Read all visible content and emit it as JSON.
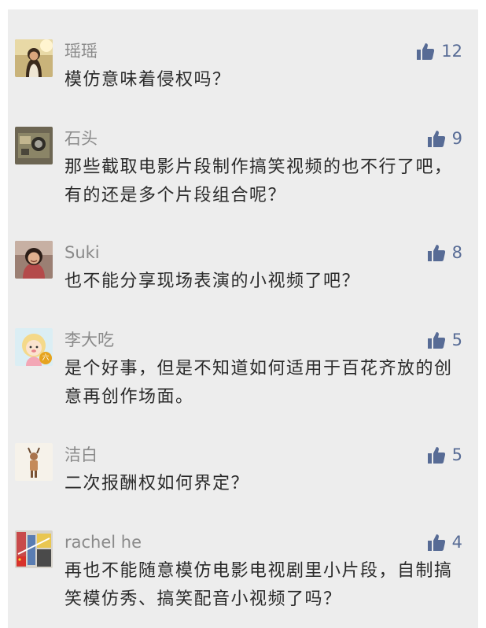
{
  "comments": [
    {
      "name": "瑶瑶",
      "text": "模仿意味着侵权吗？",
      "likes": "12",
      "avatar": "woman-in-sunlight-avatar"
    },
    {
      "name": "石头",
      "text": "那些截取电影片段制作搞笑视频的也不行了吧，有的还是多个片段组合呢？",
      "likes": "9",
      "avatar": "camera-gear-avatar"
    },
    {
      "name": "Suki",
      "text": "也不能分享现场表演的小视频了吧？",
      "likes": "8",
      "avatar": "smiling-woman-avatar"
    },
    {
      "name": "李大吃",
      "text": "是个好事，但是不知道如何适用于百花齐放的创意再创作场面。",
      "likes": "5",
      "avatar": "cartoon-girl-avatar",
      "badge": "六"
    },
    {
      "name": "洁白",
      "text": "二次报酬权如何界定？",
      "likes": "5",
      "avatar": "deer-figure-avatar"
    },
    {
      "name": "rachel he",
      "text": "再也不能随意模仿电影电视剧里小片段，自制搞笑模仿秀、搞笑配音小视频了吗？",
      "likes": "4",
      "avatar": "street-scene-avatar"
    }
  ],
  "colors": {
    "like": "#576b95",
    "name": "#8a8a8a",
    "text": "#2a2a2a",
    "panel": "#ededed"
  },
  "icons": {
    "like": "thumbs-up-icon"
  }
}
